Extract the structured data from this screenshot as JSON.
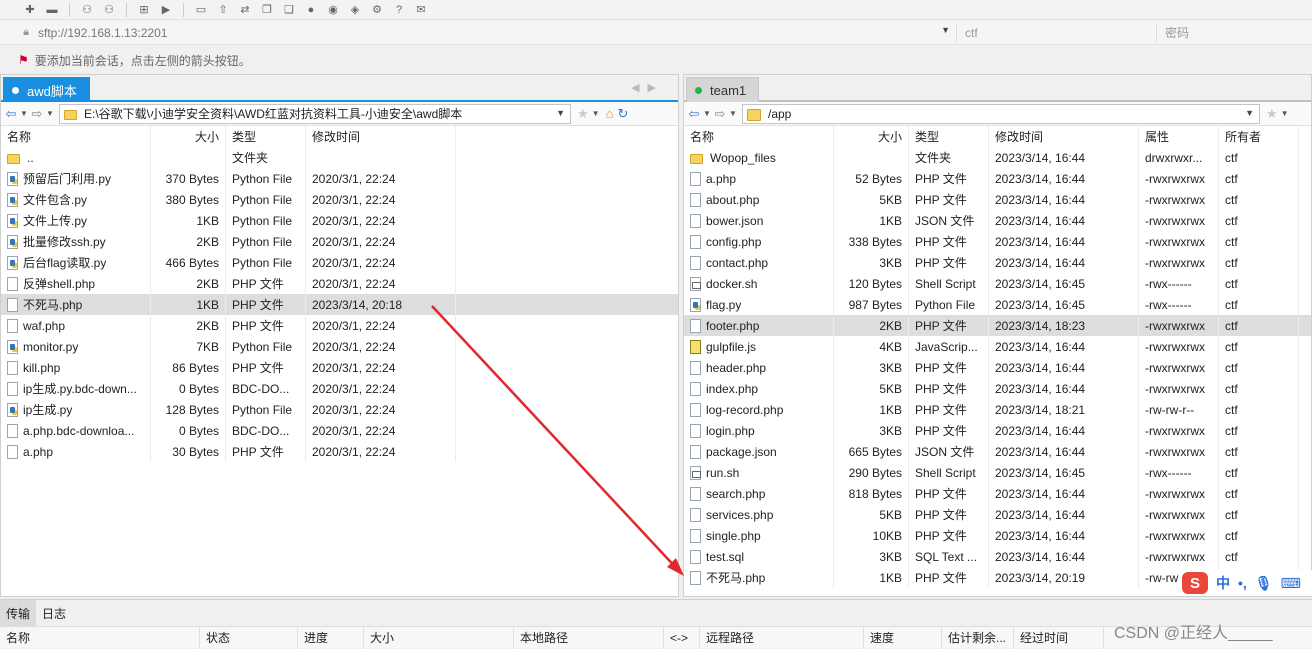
{
  "connection": {
    "address": "sftp://192.168.1.13:2201",
    "user_placeholder": "ctf",
    "password_placeholder": "密码"
  },
  "hint": "要添加当前会话，点击左侧的箭头按钮。",
  "left": {
    "tab_label": "awd脚本",
    "path": "E:\\谷歌下载\\小迪学安全资料\\AWD红蓝对抗资料工具-小迪安全\\awd脚本",
    "columns": {
      "name": "名称",
      "size": "大小",
      "type": "类型",
      "mtime": "修改时间"
    },
    "rows": [
      {
        "name": "..",
        "size": "",
        "type": "文件夹",
        "mtime": "",
        "icon": "folder"
      },
      {
        "name": "预留后门利用.py",
        "size": "370 Bytes",
        "type": "Python File",
        "mtime": "2020/3/1, 22:24",
        "icon": "py"
      },
      {
        "name": "文件包含.py",
        "size": "380 Bytes",
        "type": "Python File",
        "mtime": "2020/3/1, 22:24",
        "icon": "py"
      },
      {
        "name": "文件上传.py",
        "size": "1KB",
        "type": "Python File",
        "mtime": "2020/3/1, 22:24",
        "icon": "py"
      },
      {
        "name": "批量修改ssh.py",
        "size": "2KB",
        "type": "Python File",
        "mtime": "2020/3/1, 22:24",
        "icon": "py"
      },
      {
        "name": "后台flag读取.py",
        "size": "466 Bytes",
        "type": "Python File",
        "mtime": "2020/3/1, 22:24",
        "icon": "py"
      },
      {
        "name": "反弹shell.php",
        "size": "2KB",
        "type": "PHP 文件",
        "mtime": "2020/3/1, 22:24",
        "icon": "file"
      },
      {
        "name": "不死马.php",
        "size": "1KB",
        "type": "PHP 文件",
        "mtime": "2023/3/14, 20:18",
        "icon": "file",
        "selected": true
      },
      {
        "name": "waf.php",
        "size": "2KB",
        "type": "PHP 文件",
        "mtime": "2020/3/1, 22:24",
        "icon": "file"
      },
      {
        "name": "monitor.py",
        "size": "7KB",
        "type": "Python File",
        "mtime": "2020/3/1, 22:24",
        "icon": "py"
      },
      {
        "name": "kill.php",
        "size": "86 Bytes",
        "type": "PHP 文件",
        "mtime": "2020/3/1, 22:24",
        "icon": "file"
      },
      {
        "name": "ip生成.py.bdc-down...",
        "size": "0 Bytes",
        "type": "BDC-DO...",
        "mtime": "2020/3/1, 22:24",
        "icon": "file"
      },
      {
        "name": "ip生成.py",
        "size": "128 Bytes",
        "type": "Python File",
        "mtime": "2020/3/1, 22:24",
        "icon": "py"
      },
      {
        "name": "a.php.bdc-downloa...",
        "size": "0 Bytes",
        "type": "BDC-DO...",
        "mtime": "2020/3/1, 22:24",
        "icon": "file"
      },
      {
        "name": "a.php",
        "size": "30 Bytes",
        "type": "PHP 文件",
        "mtime": "2020/3/1, 22:24",
        "icon": "file"
      }
    ]
  },
  "right": {
    "tab_label": "team1",
    "path": "/app",
    "columns": {
      "name": "名称",
      "size": "大小",
      "type": "类型",
      "mtime": "修改时间",
      "perm": "属性",
      "owner": "所有者"
    },
    "rows": [
      {
        "name": "Wopop_files",
        "size": "",
        "type": "文件夹",
        "mtime": "2023/3/14, 16:44",
        "perm": "drwxrwxr...",
        "owner": "ctf",
        "icon": "folder"
      },
      {
        "name": "a.php",
        "size": "52 Bytes",
        "type": "PHP 文件",
        "mtime": "2023/3/14, 16:44",
        "perm": "-rwxrwxrwx",
        "owner": "ctf",
        "icon": "file"
      },
      {
        "name": "about.php",
        "size": "5KB",
        "type": "PHP 文件",
        "mtime": "2023/3/14, 16:44",
        "perm": "-rwxrwxrwx",
        "owner": "ctf",
        "icon": "file"
      },
      {
        "name": "bower.json",
        "size": "1KB",
        "type": "JSON 文件",
        "mtime": "2023/3/14, 16:44",
        "perm": "-rwxrwxrwx",
        "owner": "ctf",
        "icon": "file"
      },
      {
        "name": "config.php",
        "size": "338 Bytes",
        "type": "PHP 文件",
        "mtime": "2023/3/14, 16:44",
        "perm": "-rwxrwxrwx",
        "owner": "ctf",
        "icon": "file"
      },
      {
        "name": "contact.php",
        "size": "3KB",
        "type": "PHP 文件",
        "mtime": "2023/3/14, 16:44",
        "perm": "-rwxrwxrwx",
        "owner": "ctf",
        "icon": "file"
      },
      {
        "name": "docker.sh",
        "size": "120 Bytes",
        "type": "Shell Script",
        "mtime": "2023/3/14, 16:45",
        "perm": "-rwx------",
        "owner": "ctf",
        "icon": "sh"
      },
      {
        "name": "flag.py",
        "size": "987 Bytes",
        "type": "Python File",
        "mtime": "2023/3/14, 16:45",
        "perm": "-rwx------",
        "owner": "ctf",
        "icon": "py"
      },
      {
        "name": "footer.php",
        "size": "2KB",
        "type": "PHP 文件",
        "mtime": "2023/3/14, 18:23",
        "perm": "-rwxrwxrwx",
        "owner": "ctf",
        "icon": "file",
        "selected": true
      },
      {
        "name": "gulpfile.js",
        "size": "4KB",
        "type": "JavaScrip...",
        "mtime": "2023/3/14, 16:44",
        "perm": "-rwxrwxrwx",
        "owner": "ctf",
        "icon": "js"
      },
      {
        "name": "header.php",
        "size": "3KB",
        "type": "PHP 文件",
        "mtime": "2023/3/14, 16:44",
        "perm": "-rwxrwxrwx",
        "owner": "ctf",
        "icon": "file"
      },
      {
        "name": "index.php",
        "size": "5KB",
        "type": "PHP 文件",
        "mtime": "2023/3/14, 16:44",
        "perm": "-rwxrwxrwx",
        "owner": "ctf",
        "icon": "file"
      },
      {
        "name": "log-record.php",
        "size": "1KB",
        "type": "PHP 文件",
        "mtime": "2023/3/14, 18:21",
        "perm": "-rw-rw-r--",
        "owner": "ctf",
        "icon": "file"
      },
      {
        "name": "login.php",
        "size": "3KB",
        "type": "PHP 文件",
        "mtime": "2023/3/14, 16:44",
        "perm": "-rwxrwxrwx",
        "owner": "ctf",
        "icon": "file"
      },
      {
        "name": "package.json",
        "size": "665 Bytes",
        "type": "JSON 文件",
        "mtime": "2023/3/14, 16:44",
        "perm": "-rwxrwxrwx",
        "owner": "ctf",
        "icon": "file"
      },
      {
        "name": "run.sh",
        "size": "290 Bytes",
        "type": "Shell Script",
        "mtime": "2023/3/14, 16:45",
        "perm": "-rwx------",
        "owner": "ctf",
        "icon": "sh"
      },
      {
        "name": "search.php",
        "size": "818 Bytes",
        "type": "PHP 文件",
        "mtime": "2023/3/14, 16:44",
        "perm": "-rwxrwxrwx",
        "owner": "ctf",
        "icon": "file"
      },
      {
        "name": "services.php",
        "size": "5KB",
        "type": "PHP 文件",
        "mtime": "2023/3/14, 16:44",
        "perm": "-rwxrwxrwx",
        "owner": "ctf",
        "icon": "file"
      },
      {
        "name": "single.php",
        "size": "10KB",
        "type": "PHP 文件",
        "mtime": "2023/3/14, 16:44",
        "perm": "-rwxrwxrwx",
        "owner": "ctf",
        "icon": "file"
      },
      {
        "name": "test.sql",
        "size": "3KB",
        "type": "SQL Text ...",
        "mtime": "2023/3/14, 16:44",
        "perm": "-rwxrwxrwx",
        "owner": "ctf",
        "icon": "file"
      },
      {
        "name": "不死马.php",
        "size": "1KB",
        "type": "PHP 文件",
        "mtime": "2023/3/14, 20:19",
        "perm": "-rw-rw",
        "owner": "",
        "icon": "file"
      }
    ]
  },
  "bottom": {
    "tabs": [
      "传输",
      "日志"
    ],
    "columns": [
      "名称",
      "状态",
      "进度",
      "大小",
      "本地路径",
      "<->",
      "远程路径",
      "速度",
      "估计剩余...",
      "经过时间"
    ]
  },
  "ime": {
    "logo": "S",
    "lang": "中",
    "punct": "•,"
  },
  "watermark": "CSDN @正经人_____",
  "colors": {
    "accent": "#1a8fe0",
    "arrow": "#e0282e"
  }
}
